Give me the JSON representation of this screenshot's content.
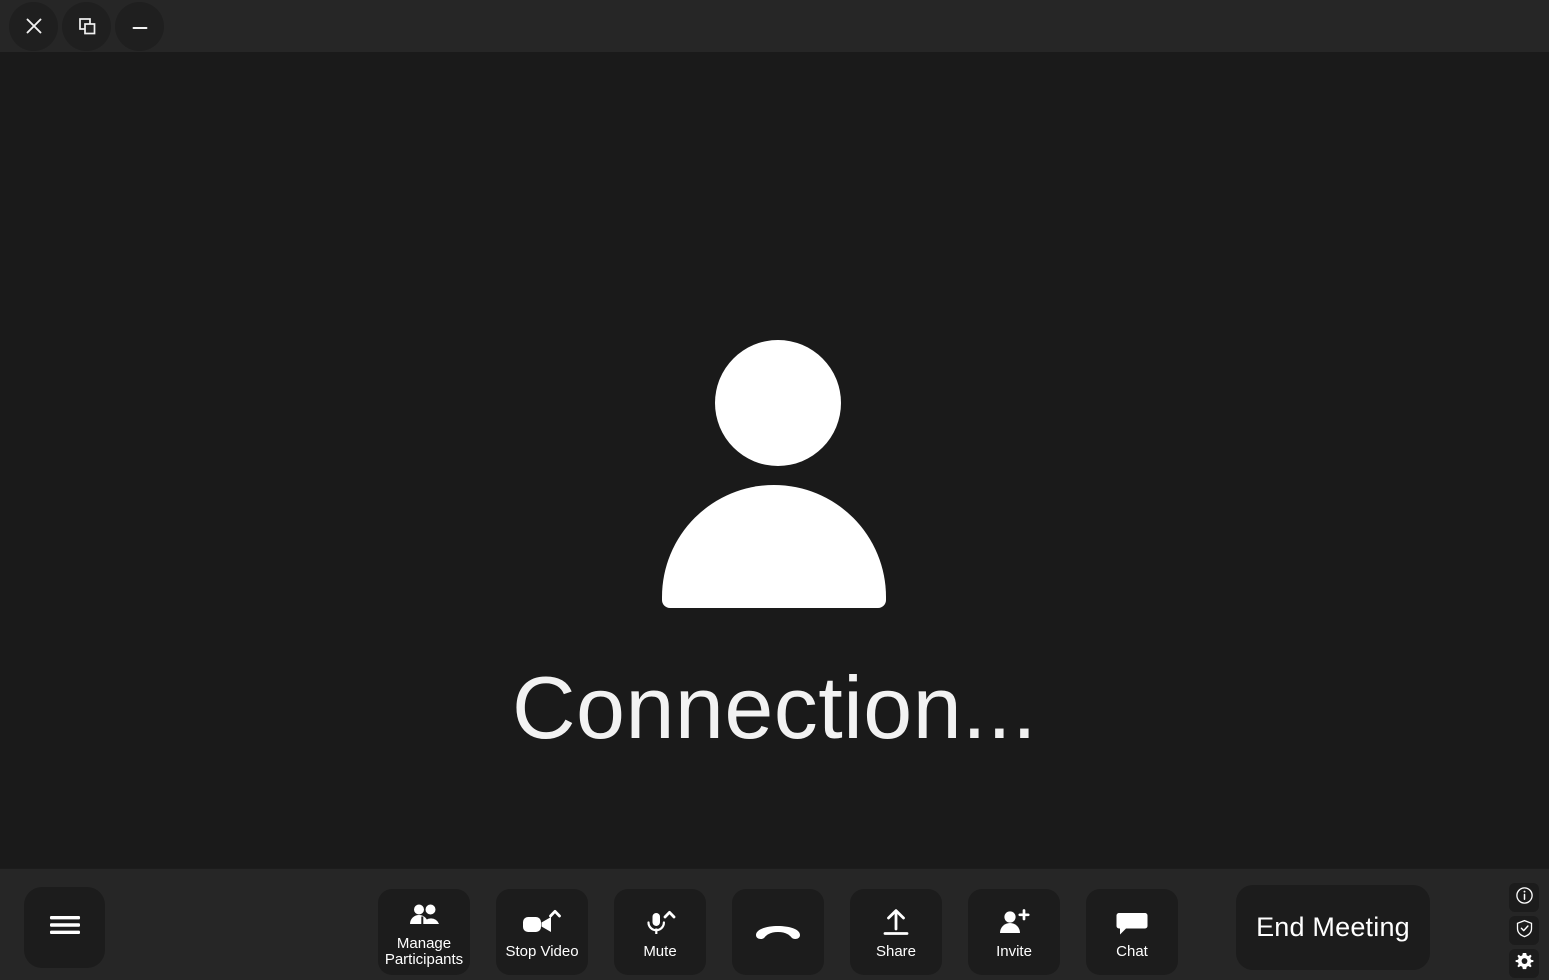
{
  "window": {
    "controls": [
      {
        "name": "close",
        "icon": "close-icon",
        "label": "Close"
      },
      {
        "name": "restore",
        "icon": "restore-window-icon",
        "label": "Restore"
      },
      {
        "name": "minimize",
        "icon": "minimize-icon",
        "label": "Minimize"
      }
    ]
  },
  "stage": {
    "avatar_icon": "user-avatar-placeholder-icon",
    "status_text": "Connection..."
  },
  "toolbar": {
    "menu": {
      "label": "Menu",
      "icon": "hamburger-menu-icon"
    },
    "items": [
      {
        "id": "manage-participants",
        "label": "Manage\nParticipants",
        "icon": "participants-icon"
      },
      {
        "id": "stop-video",
        "label": "Stop Video",
        "icon": "video-camera-icon"
      },
      {
        "id": "mute",
        "label": "Mute",
        "icon": "microphone-icon"
      },
      {
        "id": "hangup",
        "label": "",
        "icon": "hangup-phone-icon"
      },
      {
        "id": "share",
        "label": "Share",
        "icon": "share-upload-icon"
      },
      {
        "id": "invite",
        "label": "Invite",
        "icon": "invite-person-plus-icon"
      },
      {
        "id": "chat",
        "label": "Chat",
        "icon": "chat-bubble-icon"
      }
    ],
    "end_meeting": {
      "label": "End Meeting"
    },
    "utility": [
      {
        "id": "info",
        "label": "Info",
        "icon": "info-circle-icon"
      },
      {
        "id": "security",
        "label": "Security",
        "icon": "shield-check-icon"
      },
      {
        "id": "settings",
        "label": "Settings",
        "icon": "gear-icon"
      }
    ]
  },
  "colors": {
    "stage_background": "#1a1a1a",
    "chrome_background": "#262626",
    "button_background": "#1c1c1c",
    "foreground": "#ffffff"
  }
}
